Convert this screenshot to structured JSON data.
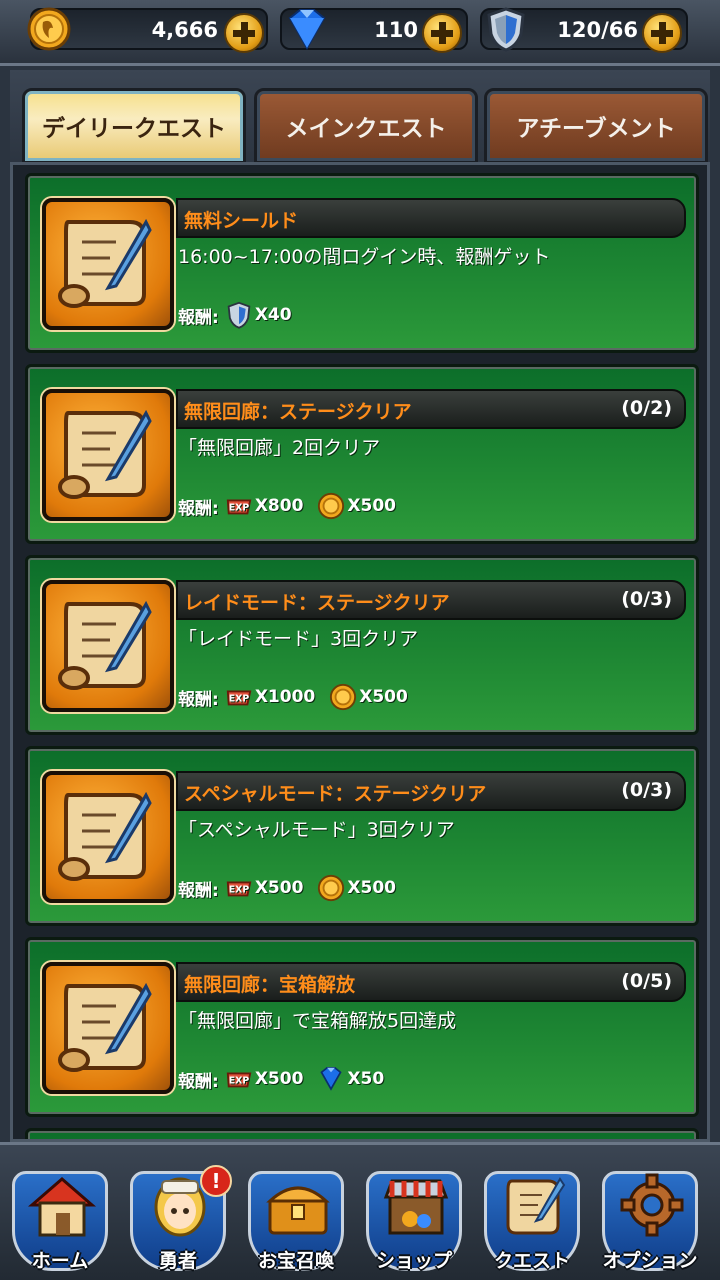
{
  "resources": {
    "coins": "4,666",
    "gems": "110",
    "shields": "120/66"
  },
  "tabs": [
    {
      "label": "デイリークエスト",
      "active": true
    },
    {
      "label": "メインクエスト",
      "active": false
    },
    {
      "label": "アチーブメント",
      "active": false
    }
  ],
  "quests": [
    {
      "title": "無料シールド",
      "progress": "",
      "description": "16:00~17:00の間ログイン時、報酬ゲット",
      "reward_label": "報酬:",
      "rewards": [
        {
          "icon": "shield-icon",
          "amount": "X40"
        }
      ]
    },
    {
      "title": "無限回廊：ステージクリア",
      "progress": "(0/2)",
      "description": "「無限回廊」2回クリア",
      "reward_label": "報酬:",
      "rewards": [
        {
          "icon": "exp-icon",
          "amount": "X800"
        },
        {
          "icon": "coin-icon",
          "amount": "X500"
        }
      ]
    },
    {
      "title": "レイドモード：ステージクリア",
      "progress": "(0/3)",
      "description": "「レイドモード」3回クリア",
      "reward_label": "報酬:",
      "rewards": [
        {
          "icon": "exp-icon",
          "amount": "X1000"
        },
        {
          "icon": "coin-icon",
          "amount": "X500"
        }
      ]
    },
    {
      "title": "スペシャルモード：ステージクリア",
      "progress": "(0/3)",
      "description": "「スペシャルモード」3回クリア",
      "reward_label": "報酬:",
      "rewards": [
        {
          "icon": "exp-icon",
          "amount": "X500"
        },
        {
          "icon": "coin-icon",
          "amount": "X500"
        }
      ]
    },
    {
      "title": "無限回廊：宝箱解放",
      "progress": "(0/5)",
      "description": "「無限回廊」で宝箱解放5回達成",
      "reward_label": "報酬:",
      "rewards": [
        {
          "icon": "exp-icon",
          "amount": "X500"
        },
        {
          "icon": "gem-icon",
          "amount": "X50"
        }
      ]
    }
  ],
  "nav": [
    {
      "label": "ホーム",
      "icon": "home-icon"
    },
    {
      "label": "勇者",
      "icon": "hero-icon",
      "badge": "!"
    },
    {
      "label": "お宝召喚",
      "icon": "treasure-chest-icon"
    },
    {
      "label": "ショップ",
      "icon": "shop-icon"
    },
    {
      "label": "クエスト",
      "icon": "scroll-icon"
    },
    {
      "label": "オプション",
      "icon": "gear-icon"
    }
  ],
  "colors": {
    "quest_title": "#ff8d1a",
    "card_green": "#2c9a3a",
    "active_tab": "#f6e08a",
    "nav_blue": "#2a6fc8"
  }
}
